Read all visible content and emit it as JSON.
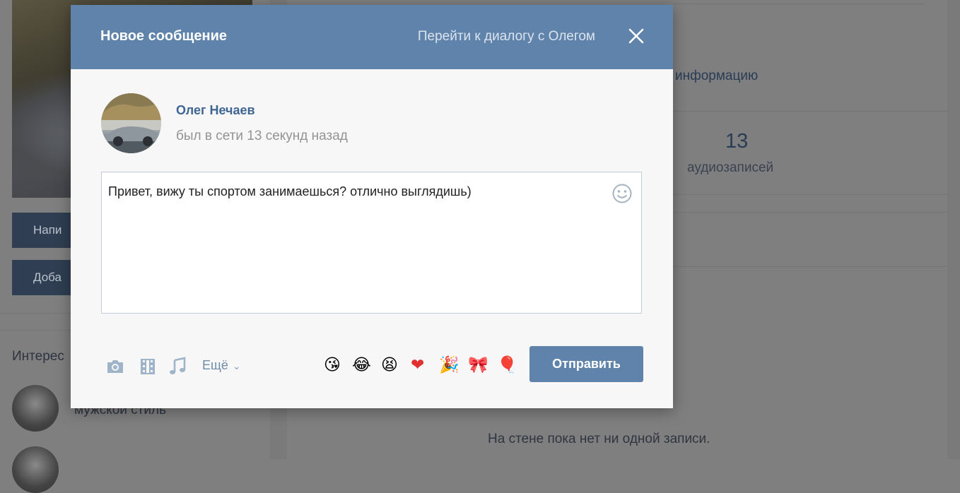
{
  "background": {
    "left_buttons": [
      "Напи",
      "Доба"
    ],
    "info_link_fragment": "информацию",
    "audio_count": "13",
    "audio_label": "аудиозаписей",
    "interests_label": "Интерес",
    "group_name": "мужской стиль",
    "wall_empty_text": "На стене пока нет ни одной записи."
  },
  "modal": {
    "title": "Новое сообщение",
    "goto_dialog_link": "Перейти к диалогу с Олегом",
    "close_icon": "close-icon",
    "recipient": {
      "name": "Олег Нечаев",
      "status": "был в сети 13 секунд назад"
    },
    "message_text": "Привет, вижу ты спортом занимаешься? отлично выглядишь)",
    "toolbar": {
      "icons": [
        "camera-icon",
        "video-icon",
        "music-icon"
      ],
      "more_label": "Ещё"
    },
    "quick_emojis": [
      "😘",
      "😂",
      "😫",
      "❤",
      "🎉",
      "🎀",
      "🎈"
    ],
    "send_label": "Отправить",
    "colors": {
      "header": "#5f83ab",
      "name_link": "#3f6592",
      "send_button": "#5f83ab"
    }
  }
}
